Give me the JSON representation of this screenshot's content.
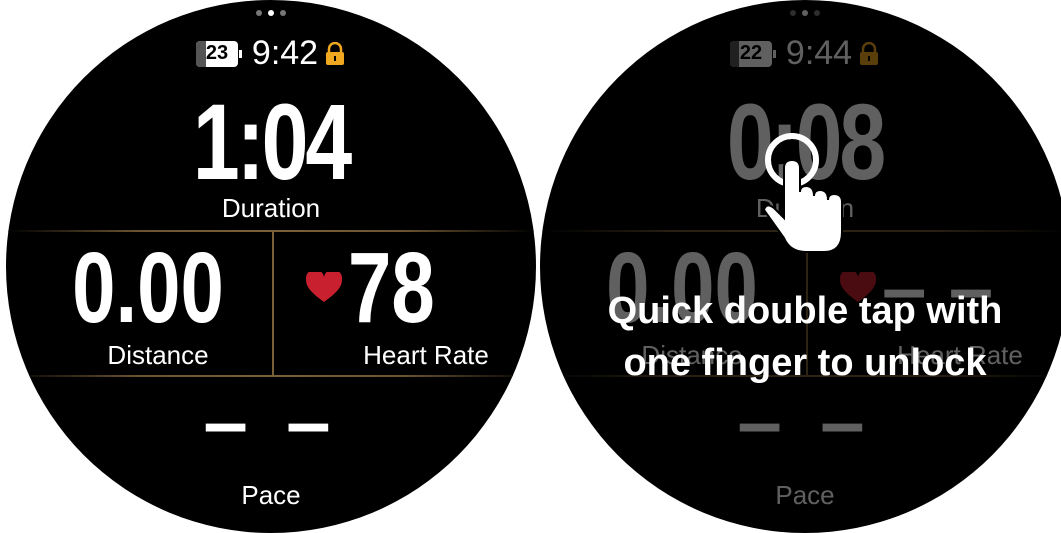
{
  "screens": [
    {
      "battery_level": "23",
      "time": "9:42",
      "duration_value": "1:04",
      "duration_label": "Duration",
      "distance_value": "0.00",
      "distance_label": "Distance",
      "heart_rate_value": "78",
      "heart_rate_label": "Heart Rate",
      "pace_value": "– –",
      "pace_label": "Pace"
    },
    {
      "battery_level": "22",
      "time": "9:44",
      "duration_value": "0:08",
      "duration_label": "Duration",
      "distance_value": "0.00",
      "distance_label": "Distance",
      "heart_rate_value": "– –",
      "heart_rate_label": "Heart Rate",
      "pace_value": "– –",
      "pace_label": "Pace",
      "unlock_message": "Quick double tap with one finger to unlock"
    }
  ],
  "colors": {
    "accent_gold": "#7a6035",
    "lock_orange": "#f0a820",
    "heart_red": "#c8202e"
  },
  "icons": [
    "lock-icon",
    "heart-icon",
    "battery-icon",
    "tap-hand-icon"
  ]
}
